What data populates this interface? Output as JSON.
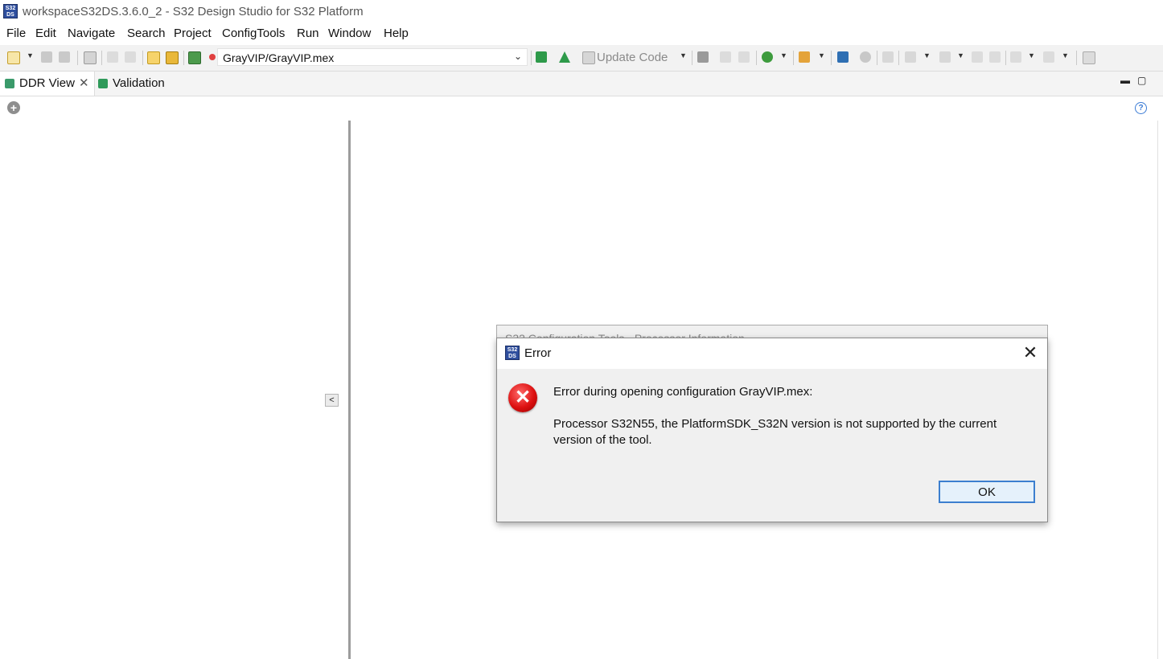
{
  "window": {
    "title": "workspaceS32DS.3.6.0_2 - S32 Design Studio for S32 Platform",
    "logo_text": "S32\nDS"
  },
  "menu": {
    "items": [
      "File",
      "Edit",
      "Navigate",
      "Search",
      "Project",
      "ConfigTools",
      "Run",
      "Window",
      "Help"
    ]
  },
  "toolbar": {
    "config_combo_value": "GrayVIP/GrayVIP.mex",
    "update_code_label": "Update Code"
  },
  "tabs": [
    {
      "label": "DDR View",
      "close": "✕"
    },
    {
      "label": "Validation"
    }
  ],
  "view_controls": {
    "minimize": "▬",
    "maximize": "▢",
    "add": "+",
    "help": "?"
  },
  "splitter": {
    "collapse_label": "<"
  },
  "background_dialog": {
    "title": "S32 Configuration Tools - Processor Information"
  },
  "dialog": {
    "title": "Error",
    "close": "✕",
    "icon": "error-icon",
    "message_line1": "Error during opening configuration GrayVIP.mex:",
    "message_line2": "Processor S32N55, the PlatformSDK_S32N version is not supported by the current version of the tool.",
    "ok_label": "OK"
  },
  "colors": {
    "accent": "#3c7fcf",
    "error": "#d11111",
    "toolbar_bg": "#f2f2f2"
  }
}
